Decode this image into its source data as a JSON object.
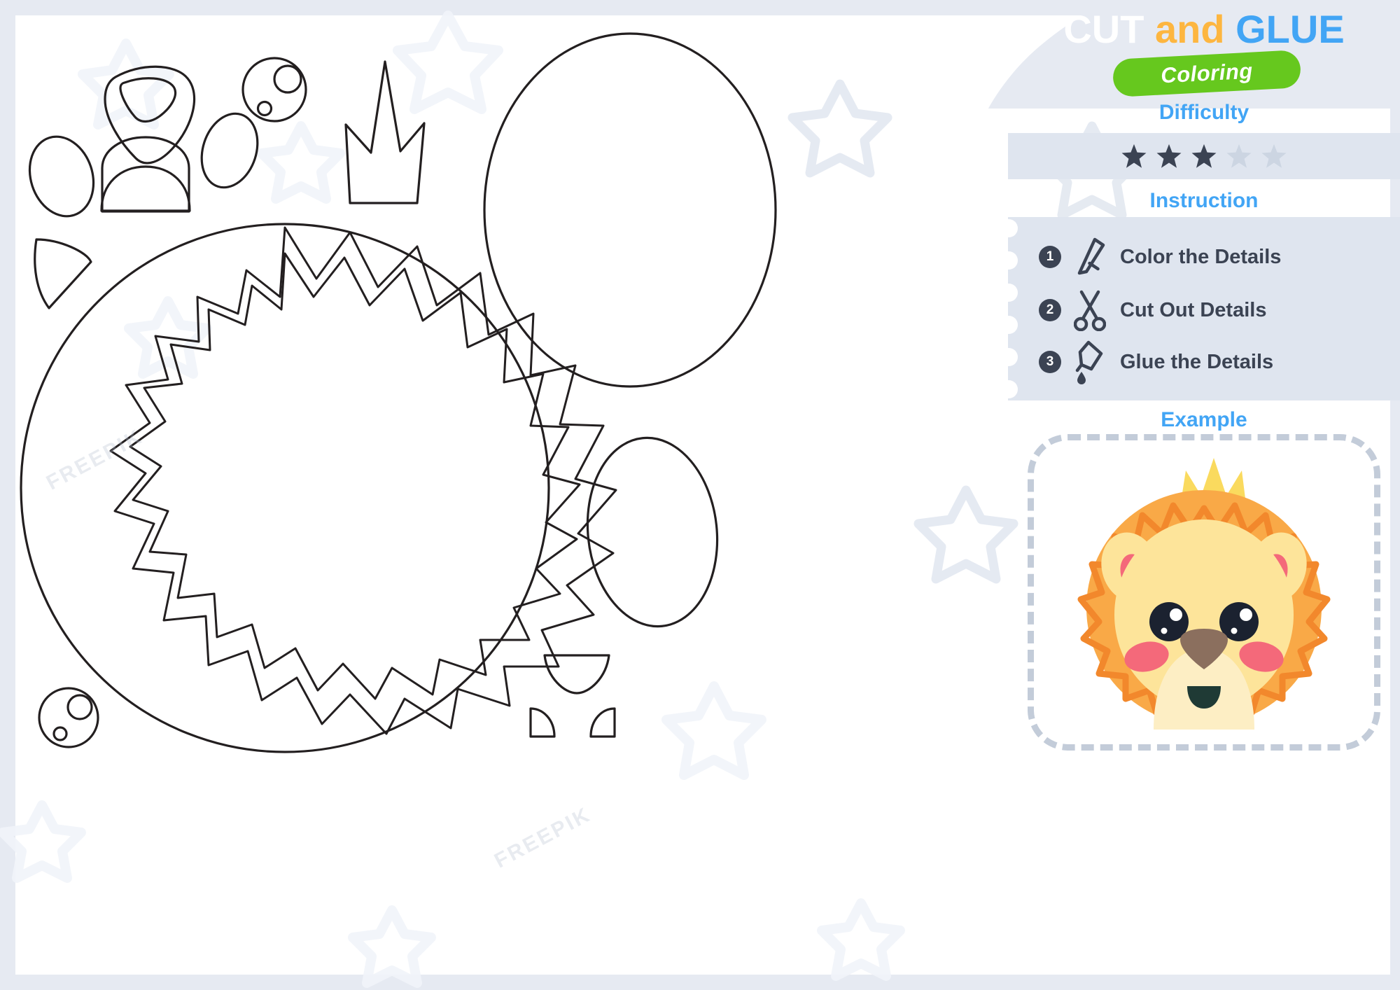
{
  "page": {
    "background_color": "#e6eaf2",
    "card_color": "#ffffff",
    "panel_color": "#dfe5ef"
  },
  "header": {
    "title_part_1": "CUT",
    "title_part_2": "and",
    "title_part_3": "GLUE",
    "title_color_1": "#ffffff",
    "title_color_2": "#fdb640",
    "title_color_3": "#42a5f5",
    "badge_label": "Coloring",
    "badge_color": "#66c81e"
  },
  "difficulty": {
    "heading": "Difficulty",
    "heading_color": "#42a5f5",
    "total_stars": 5,
    "filled_stars": 3,
    "filled_color": "#3b4353",
    "empty_color": "#ccd5e2"
  },
  "instruction": {
    "heading": "Instruction",
    "heading_color": "#42a5f5",
    "steps": [
      {
        "number": "1",
        "icon": "pencil-icon",
        "label": "Color the Details"
      },
      {
        "number": "2",
        "icon": "scissors-icon",
        "label": "Cut Out Details"
      },
      {
        "number": "3",
        "icon": "glue-bottle-icon",
        "label": "Glue the Details"
      }
    ]
  },
  "example": {
    "heading": "Example",
    "heading_color": "#42a5f5",
    "subject": "lion-face-with-crown",
    "colors": {
      "mane_outer": "#f9a947",
      "mane_zigzag": "#f2882c",
      "face": "#fde49a",
      "muzzle": "#fdeec4",
      "ear_inner": "#f4697a",
      "cheek": "#f4697a",
      "crown": "#fada5e",
      "nose": "#8b6f5e",
      "eye": "#1b2230",
      "mouth": "#1f3a35"
    }
  },
  "worksheet": {
    "pieces": [
      {
        "name": "nose-triangle",
        "type": "rounded-triangle-with-inner"
      },
      {
        "name": "eye-circle-left",
        "type": "circle-with-two-highlights"
      },
      {
        "name": "eye-circle-right",
        "type": "circle-with-two-highlights"
      },
      {
        "name": "ear-oval-left",
        "type": "oval"
      },
      {
        "name": "ear-oval-right",
        "type": "oval"
      },
      {
        "name": "muzzle-dome",
        "type": "half-dome"
      },
      {
        "name": "crown",
        "type": "three-point-crown"
      },
      {
        "name": "cheek-wedge",
        "type": "quarter-wedge"
      },
      {
        "name": "face-oval-large",
        "type": "large-oval"
      },
      {
        "name": "face-oval-small",
        "type": "oval"
      },
      {
        "name": "mane-circle",
        "type": "circle-with-zigzag-ring"
      },
      {
        "name": "mouth-dome",
        "type": "small-half-dome"
      },
      {
        "name": "tooth-left",
        "type": "tiny-wedge"
      },
      {
        "name": "tooth-right",
        "type": "tiny-wedge"
      }
    ],
    "stroke_color": "#231f20"
  },
  "watermarks": {
    "text_a": "FREEPIK",
    "text_b": "FREEPIK"
  }
}
